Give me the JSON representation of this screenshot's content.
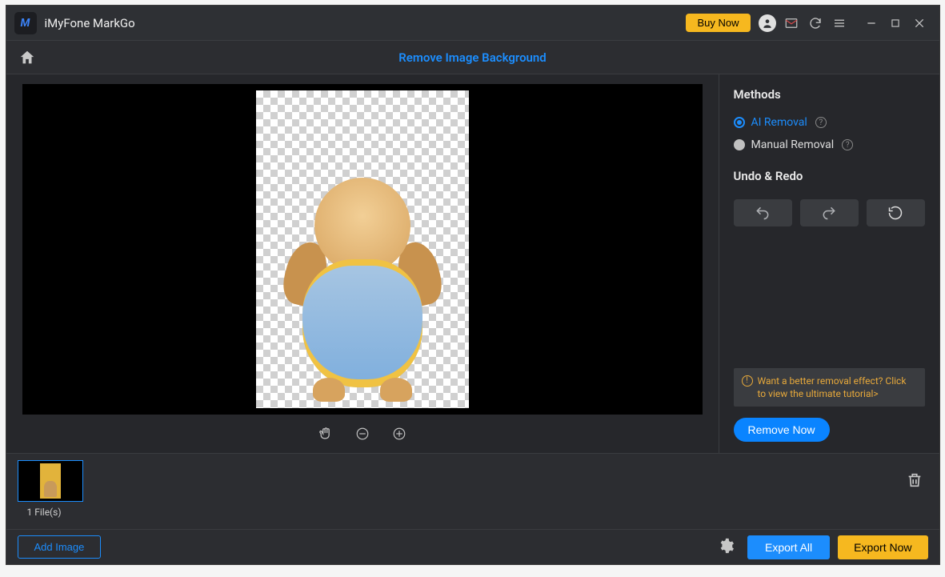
{
  "titlebar": {
    "app_name": "iMyFone MarkGo",
    "buy_now": "Buy Now"
  },
  "subheader": {
    "mode_title": "Remove Image Background"
  },
  "panel": {
    "methods_heading": "Methods",
    "ai_removal": "AI Removal",
    "manual_removal": "Manual Removal",
    "undo_redo_heading": "Undo & Redo",
    "tip_text": "Want a better removal effect? Click to view the ultimate tutorial>",
    "remove_now": "Remove Now"
  },
  "strip": {
    "file_count": "1 File(s)"
  },
  "footer": {
    "add_image": "Add Image",
    "export_all": "Export All",
    "export_now": "Export Now"
  }
}
